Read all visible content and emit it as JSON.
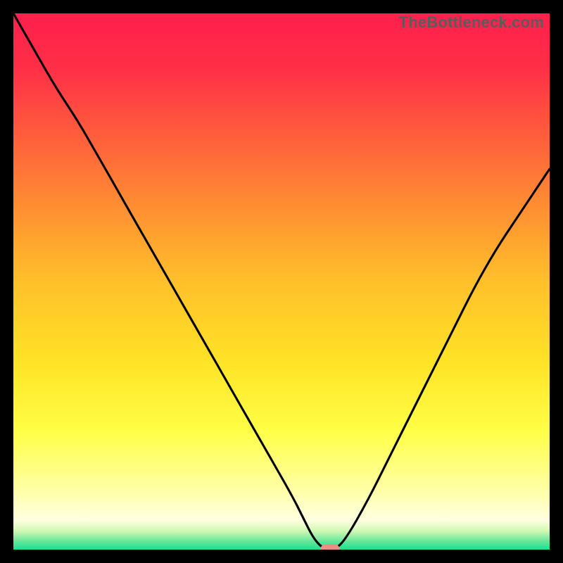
{
  "watermark": "TheBottleneck.com",
  "colors": {
    "black_frame": "#000000",
    "curve": "#000000",
    "marker": "#e98f84",
    "gradient_stops": [
      {
        "pos": 0.0,
        "color": "#ff1f4d"
      },
      {
        "pos": 0.1,
        "color": "#ff2e47"
      },
      {
        "pos": 0.22,
        "color": "#ff5a3d"
      },
      {
        "pos": 0.35,
        "color": "#ff8a33"
      },
      {
        "pos": 0.5,
        "color": "#ffc02a"
      },
      {
        "pos": 0.65,
        "color": "#ffe326"
      },
      {
        "pos": 0.78,
        "color": "#ffff47"
      },
      {
        "pos": 0.88,
        "color": "#ffff9e"
      },
      {
        "pos": 0.945,
        "color": "#ffffe0"
      },
      {
        "pos": 0.965,
        "color": "#d1f8b3"
      },
      {
        "pos": 0.985,
        "color": "#63e69a"
      },
      {
        "pos": 1.0,
        "color": "#17e38e"
      }
    ]
  },
  "chart_data": {
    "type": "line",
    "title": "",
    "xlabel": "",
    "ylabel": "",
    "xlim": [
      0,
      100
    ],
    "ylim": [
      0,
      100
    ],
    "series": [
      {
        "name": "bottleneck-curve",
        "x": [
          0,
          4,
          8,
          12,
          16,
          20,
          24,
          28,
          32,
          36,
          40,
          44,
          48,
          52,
          54,
          56,
          58,
          60,
          62,
          66,
          70,
          74,
          78,
          82,
          86,
          90,
          94,
          98,
          100
        ],
        "y": [
          100,
          93,
          86,
          80,
          73,
          66,
          59,
          52,
          45,
          38,
          31,
          24,
          17,
          10,
          6,
          2,
          0,
          0,
          2,
          9,
          17,
          25,
          33,
          41,
          49,
          56,
          62,
          68,
          71
        ]
      }
    ],
    "marker": {
      "x": 59,
      "y": 0
    }
  }
}
